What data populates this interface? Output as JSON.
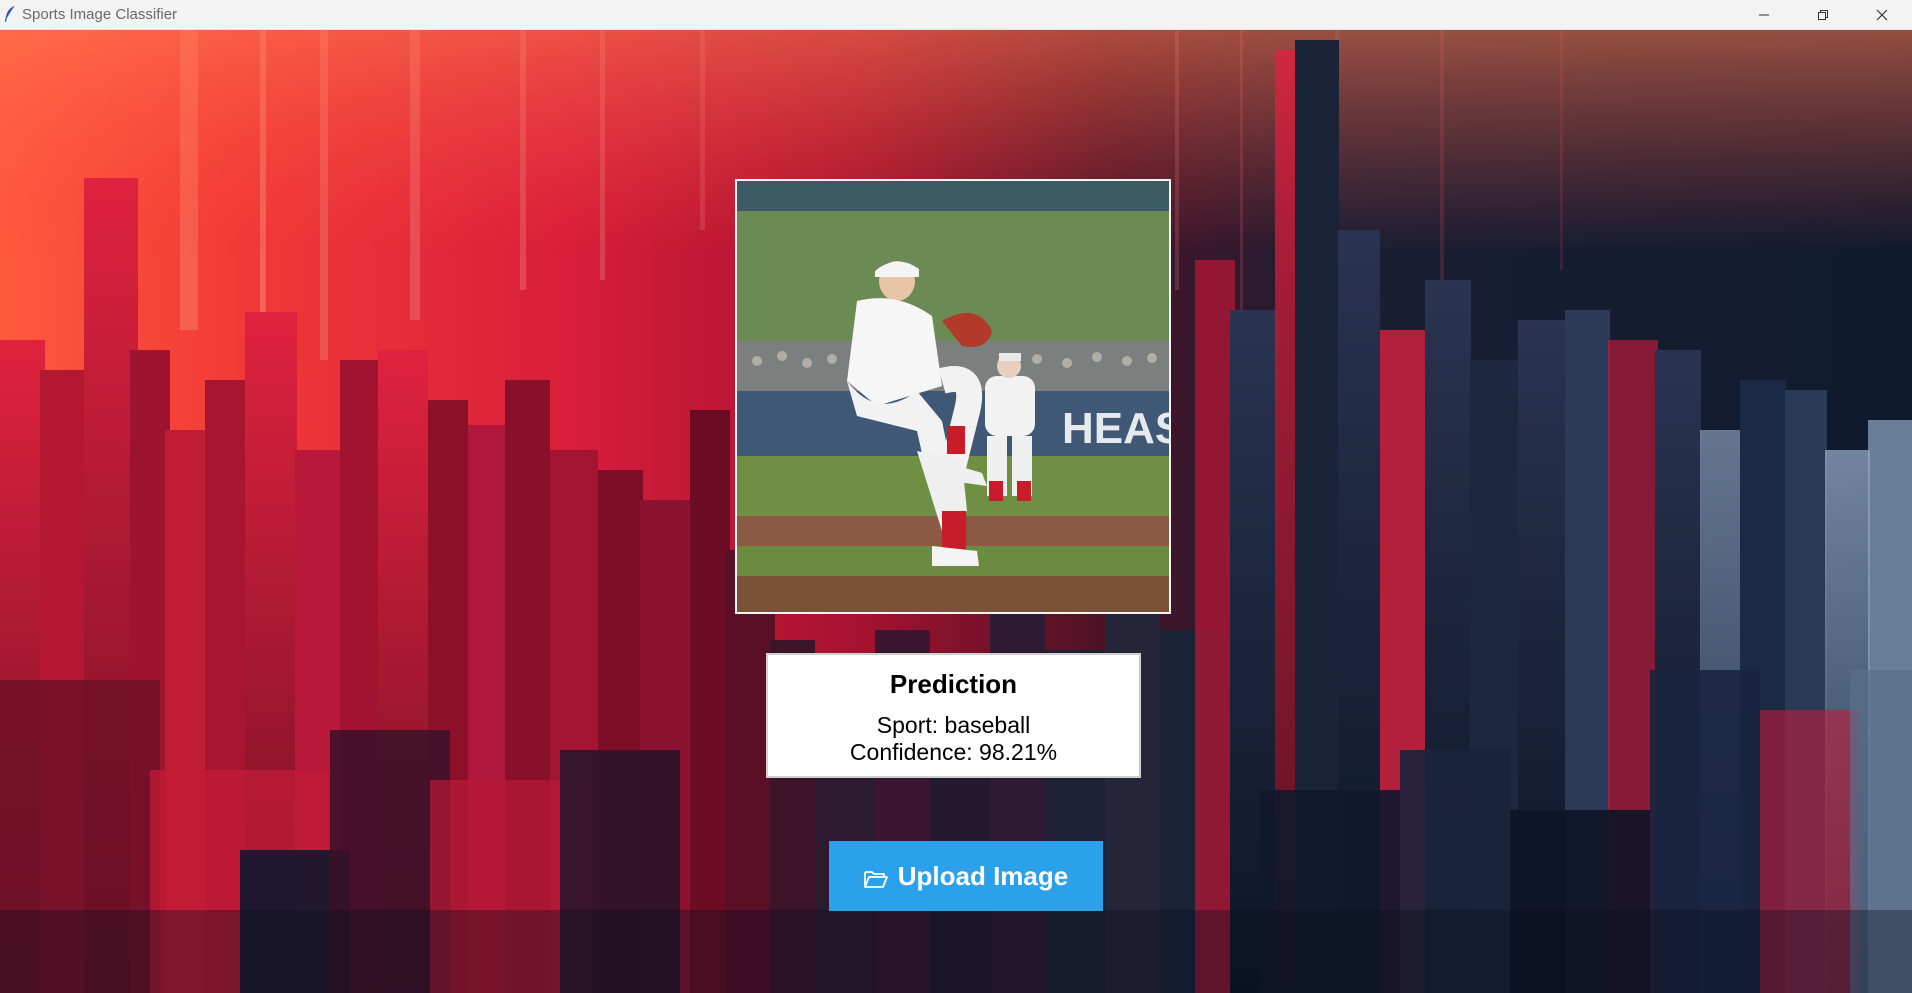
{
  "window": {
    "title": "Sports Image Classifier",
    "app_icon": "feather-icon",
    "controls": [
      "minimize-icon",
      "restore-icon",
      "close-icon"
    ]
  },
  "preview": {
    "subject": "baseball pitcher photo"
  },
  "prediction": {
    "title": "Prediction",
    "sport_text": "Sport: baseball",
    "confidence_text": "Confidence: 98.21%"
  },
  "upload_button": {
    "label": "Upload Image",
    "icon": "folder-open-icon",
    "color": "#2aa1ea"
  },
  "colors": {
    "titlebar": "#f3f3f3",
    "bg_left": "#ff5a3c",
    "bg_mid": "#a5122f",
    "bg_right": "#0f1a2e"
  }
}
